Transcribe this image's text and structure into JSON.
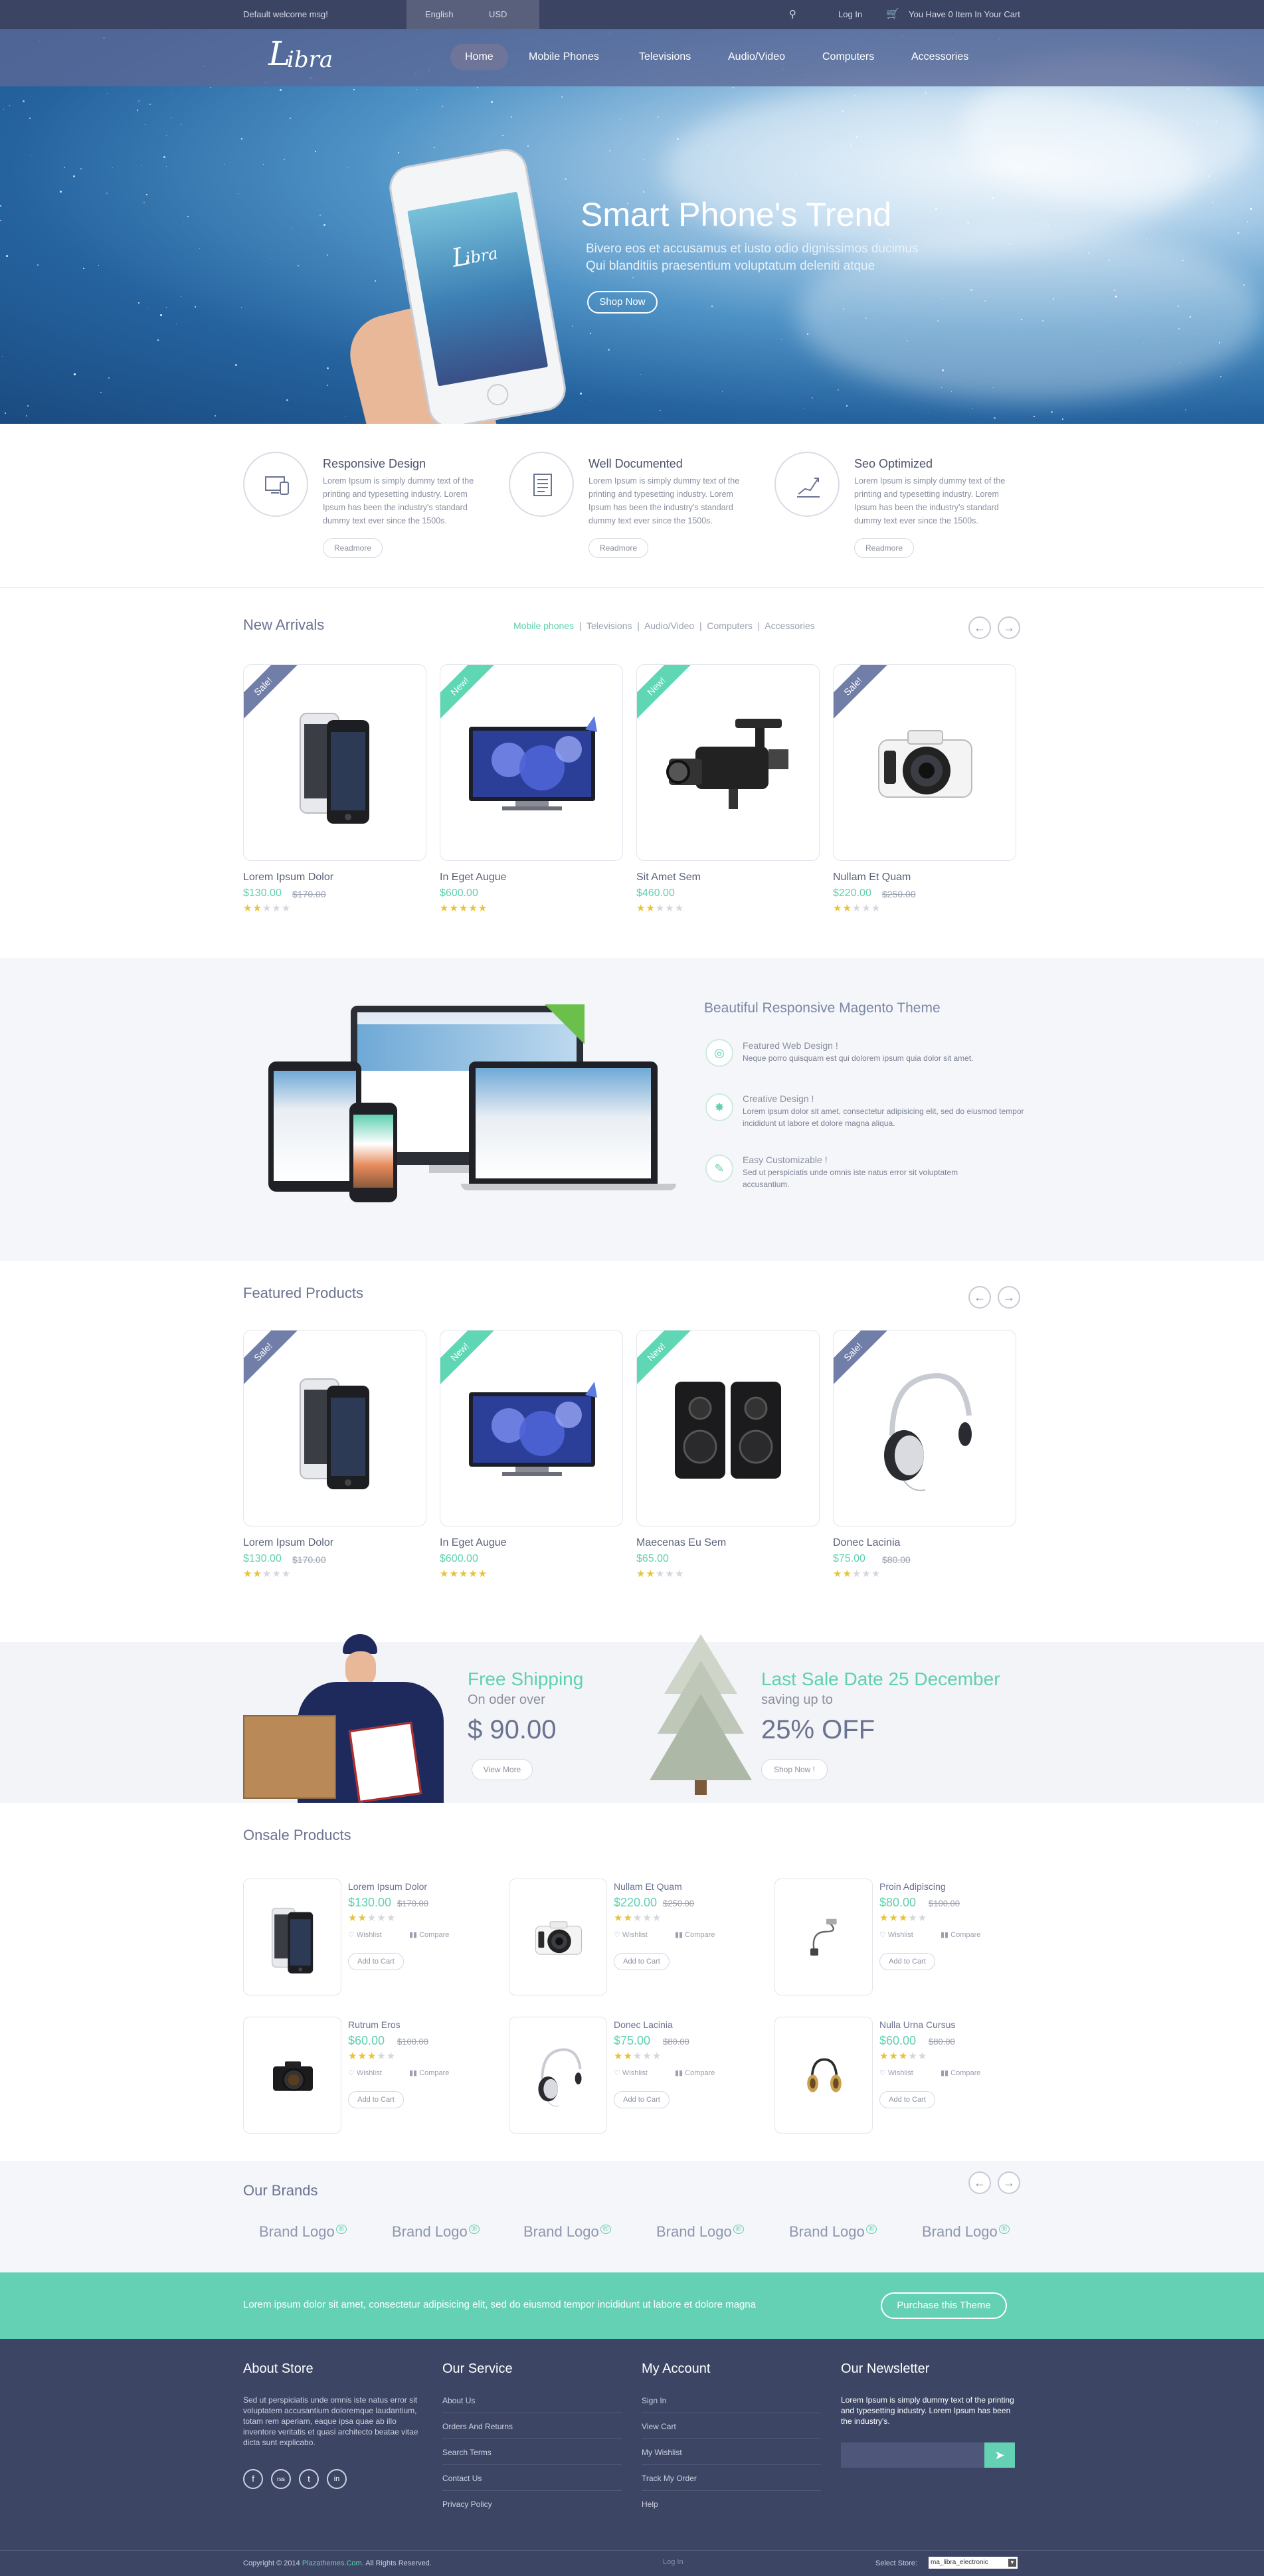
{
  "topbar": {
    "welcome": "Default welcome msg!",
    "language": "English",
    "currency": "USD",
    "login": "Log In",
    "cart": "You Have 0 Item In Your Cart"
  },
  "header": {
    "logo": "ibra",
    "logo_initial": "L",
    "nav": [
      "Home",
      "Mobile Phones",
      "Televisions",
      "Audio/Video",
      "Computers",
      "Accessories"
    ]
  },
  "hero": {
    "title": "Smart Phone's Trend",
    "line1": "Bivero eos et accusamus et iusto odio dignissimos ducimus",
    "line2": "Qui blanditiis praesentium voluptatum deleniti atque",
    "button": "Shop Now",
    "phone_logo": "ibra"
  },
  "features": [
    {
      "title": "Responsive Design",
      "text": "Lorem Ipsum is simply dummy text of the printing and typesetting industry. Lorem Ipsum has been the industry's standard dummy text ever since the 1500s.",
      "button": "Readmore",
      "icon": "devices-icon"
    },
    {
      "title": "Well Documented",
      "text": "Lorem Ipsum is simply dummy text of the printing and typesetting industry. Lorem Ipsum has been the industry's standard dummy text ever since the 1500s.",
      "button": "Readmore",
      "icon": "document-icon"
    },
    {
      "title": "Seo Optimized",
      "text": "Lorem Ipsum is simply dummy text of the printing and typesetting industry. Lorem Ipsum has been the industry's standard dummy text ever since the 1500s.",
      "button": "Readmore",
      "icon": "chart-line-icon"
    }
  ],
  "new_arrivals": {
    "title": "New Arrivals",
    "tabs": [
      "Mobile phones",
      "Televisions",
      "Audio/Video",
      "Computers",
      "Accessories"
    ],
    "products": [
      {
        "badge": "Sale!",
        "name": "Lorem Ipsum Dolor",
        "price": "$130.00",
        "old": "$170.00",
        "rating": 2,
        "image": "smartphones"
      },
      {
        "badge": "New!",
        "name": "In Eget Augue",
        "price": "$600.00",
        "old": "",
        "rating": 5,
        "image": "television"
      },
      {
        "badge": "New!",
        "name": "Sit Amet Sem",
        "price": "$460.00",
        "old": "",
        "rating": 2,
        "image": "camcorder"
      },
      {
        "badge": "Sale!",
        "name": "Nullam Et Quam",
        "price": "$220.00",
        "old": "$250.00",
        "rating": 2,
        "image": "camera"
      }
    ]
  },
  "responsive": {
    "title": "Beautiful Responsive Magento Theme",
    "items": [
      {
        "title": "Featured Web Design !",
        "text": "Neque porro quisquam est qui dolorem ipsum quia dolor sit amet.",
        "icon": "award-icon"
      },
      {
        "title": "Creative Design !",
        "text": "Lorem ipsum dolor sit amet, consectetur adipisicing elit, sed do eiusmod tempor incididunt ut labore et dolore magna aliqua.",
        "icon": "bulb-icon"
      },
      {
        "title": "Easy Customizable !",
        "text": "Sed ut perspiciatis unde omnis iste natus error sit voluptatem accusantium.",
        "icon": "customize-icon"
      }
    ]
  },
  "featured": {
    "title": "Featured Products",
    "products": [
      {
        "badge": "Sale!",
        "name": "Lorem Ipsum Dolor",
        "price": "$130.00",
        "old": "$170.00",
        "rating": 2,
        "image": "smartphones"
      },
      {
        "badge": "New!",
        "name": "In Eget Augue",
        "price": "$600.00",
        "old": "",
        "rating": 5,
        "image": "television"
      },
      {
        "badge": "New!",
        "name": "Maecenas Eu Sem",
        "price": "$65.00",
        "old": "",
        "rating": 2,
        "image": "speakers"
      },
      {
        "badge": "Sale!",
        "name": "Donec Lacinia",
        "price": "$75.00",
        "old": "$80.00",
        "rating": 2,
        "image": "headphones"
      }
    ]
  },
  "promo": {
    "left": {
      "title": "Free Shipping",
      "sub": "On oder over",
      "amount": "$ 90.00",
      "button": "View More"
    },
    "right": {
      "title": "Last Sale Date 25 December",
      "sub": "saving up to",
      "amount": "25% OFF",
      "button": "Shop Now !"
    }
  },
  "onsale": {
    "title": "Onsale Products",
    "wishlist": "Wishlist",
    "compare": "Compare",
    "add_to_cart": "Add to Cart",
    "products": [
      {
        "name": "Lorem Ipsum Dolor",
        "price": "$130.00",
        "old": "$170.00",
        "rating": 2,
        "image": "smartphones"
      },
      {
        "name": "Nullam Et Quam",
        "price": "$220.00",
        "old": "$250.00",
        "rating": 2,
        "image": "camera"
      },
      {
        "name": "Proin Adipiscing",
        "price": "$80.00",
        "old": "$100.00",
        "rating": 3,
        "image": "usb-cable"
      },
      {
        "name": "Rutrum Eros",
        "price": "$60.00",
        "old": "$100.00",
        "rating": 3,
        "image": "dslr"
      },
      {
        "name": "Donec Lacinia",
        "price": "$75.00",
        "old": "$80.00",
        "rating": 2,
        "image": "headphones"
      },
      {
        "name": "Nulla Urna Cursus",
        "price": "$60.00",
        "old": "$80.00",
        "rating": 3,
        "image": "gold-headphones"
      }
    ]
  },
  "brands": {
    "title": "Our Brands",
    "items": [
      "Brand Logo",
      "Brand Logo",
      "Brand Logo",
      "Brand Logo",
      "Brand Logo",
      "Brand Logo"
    ],
    "mark": "®"
  },
  "tealbar": {
    "text": "Lorem ipsum dolor sit amet, consectetur adipisicing elit, sed do eiusmod tempor incididunt ut labore et dolore magna",
    "button": "Purchase this Theme"
  },
  "footer": {
    "about": {
      "title": "About Store",
      "text": "Sed ut perspiciatis unde omnis iste natus error sit voluptatem accusantium doloremque laudantium, totam rem aperiam, eaque ipsa quae ab illo inventore veritatis et quasi architecto beatae vitae dicta sunt explicabo."
    },
    "social": [
      "f",
      "rss",
      "t",
      "in"
    ],
    "service": {
      "title": "Our Service",
      "links": [
        "About Us",
        "Orders And Returns",
        "Search Terms",
        "Contact Us",
        "Privacy Policy"
      ]
    },
    "account": {
      "title": "My Account",
      "links": [
        "Sign In",
        "View Cart",
        "My Wishlist",
        "Track My Order",
        "Help"
      ]
    },
    "newsletter": {
      "title": "Our Newsletter",
      "text": "Lorem Ipsum is simply dummy text of the printing and typesetting industry. Lorem Ipsum has been the industry's."
    },
    "copyright": "Copyright © 2014",
    "copyright_link": "Plazathemes.Com",
    "copyright_tail": ". All Rights Reserved.",
    "bottom_login": "Log In",
    "store_label": "Select Store:",
    "store_value": "ma_libra_electronic"
  },
  "colors": {
    "accent": "#5fd0b0",
    "navy": "#3d4565",
    "sale": "#717ea8"
  }
}
